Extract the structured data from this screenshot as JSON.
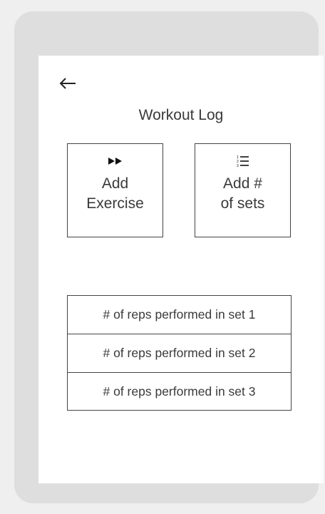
{
  "header": {
    "back_icon": "left-arrow-icon",
    "title": "Workout Log"
  },
  "actions": [
    {
      "icon": "fast-forward-icon",
      "label": "Add\nExercise"
    },
    {
      "icon": "numbered-list-icon",
      "label": "Add #\nof sets"
    }
  ],
  "sets": [
    {
      "label": "# of reps performed in set 1"
    },
    {
      "label": "# of reps performed in set 2"
    },
    {
      "label": "# of reps performed in set 3"
    }
  ],
  "colors": {
    "device_frame": "#dedede",
    "outer_background": "#efefef",
    "screen": "#ffffff",
    "text": "#3a3a3a",
    "border": "#444444"
  }
}
